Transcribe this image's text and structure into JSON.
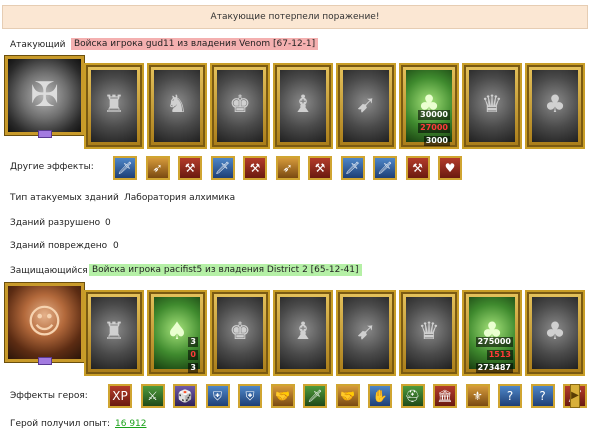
{
  "banner": "Атакующие потерпели поражение!",
  "attacker": {
    "label": "Атакующий",
    "army": "Войска игрока gud11 из владения Venom [67-12-1]",
    "units": [
      {
        "icon": "dwarf-icon",
        "style": "grey"
      },
      {
        "icon": "knight-icon",
        "style": "grey"
      },
      {
        "icon": "paladin-icon",
        "style": "grey"
      },
      {
        "icon": "griffin-icon",
        "style": "grey"
      },
      {
        "icon": "archer-icon",
        "style": "grey"
      },
      {
        "icon": "ent-icon",
        "style": "green",
        "counts": [
          {
            "v": "30000",
            "c": "w"
          },
          {
            "v": "27000",
            "c": "r"
          },
          {
            "v": "3000",
            "c": "w"
          }
        ]
      },
      {
        "icon": "warrior-icon",
        "style": "grey"
      },
      {
        "icon": "ent-icon",
        "style": "grey"
      }
    ]
  },
  "other_effects": {
    "label": "Другие эффекты:",
    "items": [
      {
        "icon": "sword-icon",
        "c": "b"
      },
      {
        "icon": "bow-icon",
        "c": "o"
      },
      {
        "icon": "axe-icon",
        "c": "r"
      },
      {
        "icon": "sword-icon",
        "c": "b"
      },
      {
        "icon": "axe-icon",
        "c": "r"
      },
      {
        "icon": "bow-icon",
        "c": "o"
      },
      {
        "icon": "axe-icon",
        "c": "r"
      },
      {
        "icon": "sword-icon",
        "c": "b"
      },
      {
        "icon": "sword-icon",
        "c": "b"
      },
      {
        "icon": "axe-icon",
        "c": "r"
      },
      {
        "icon": "heart-icon",
        "c": "r"
      }
    ]
  },
  "building_type": {
    "label": "Тип атакуемых зданий",
    "value": "Лаборатория алхимика"
  },
  "destroyed": {
    "label": "Зданий разрушено",
    "value": "0"
  },
  "damaged": {
    "label": "Зданий повреждено",
    "value": "0"
  },
  "defender": {
    "label": "Защищающийся",
    "army": "Войска игрока pacifist5 из владения District 2 [65-12-41]",
    "units": [
      {
        "icon": "dwarf-icon",
        "style": "grey"
      },
      {
        "icon": "elf-icon",
        "style": "green",
        "counts": [
          {
            "v": "3",
            "c": "w"
          },
          {
            "v": "0",
            "c": "r"
          },
          {
            "v": "3",
            "c": "w"
          }
        ]
      },
      {
        "icon": "paladin-icon",
        "style": "grey"
      },
      {
        "icon": "griffin-icon",
        "style": "grey"
      },
      {
        "icon": "archer-icon",
        "style": "grey"
      },
      {
        "icon": "warrior-icon",
        "style": "grey"
      },
      {
        "icon": "ent-icon",
        "style": "green",
        "counts": [
          {
            "v": "275000",
            "c": "w"
          },
          {
            "v": "1513",
            "c": "r"
          },
          {
            "v": "273487",
            "c": "w"
          }
        ]
      },
      {
        "icon": "ent-icon",
        "style": "grey"
      }
    ]
  },
  "hero_effects": {
    "label": "Эффекты героя:",
    "items": [
      {
        "glyph": "XP",
        "icon": "xp-icon",
        "c": "r"
      },
      {
        "glyph": "⚔",
        "icon": "swords-icon",
        "c": "g"
      },
      {
        "glyph": "🎲",
        "icon": "dice-icon",
        "c": "p"
      },
      {
        "glyph": "⛨",
        "icon": "shield-icon",
        "c": "b"
      },
      {
        "glyph": "⛨",
        "icon": "shield-icon",
        "c": "b"
      },
      {
        "glyph": "🤝",
        "icon": "handshake-icon",
        "c": "o"
      },
      {
        "glyph": "🗡",
        "icon": "sword-icon",
        "c": "g"
      },
      {
        "glyph": "🤝",
        "icon": "handshake-icon",
        "c": "o"
      },
      {
        "glyph": "✋",
        "icon": "hand-icon",
        "c": "b"
      },
      {
        "glyph": "⛑",
        "icon": "helmet-icon",
        "c": "g"
      },
      {
        "glyph": "🏛",
        "icon": "building-icon",
        "c": "r"
      },
      {
        "glyph": "⚜",
        "icon": "emblem-icon",
        "c": "o"
      },
      {
        "glyph": "?",
        "icon": "question-icon",
        "c": "b"
      },
      {
        "glyph": "?",
        "icon": "question-icon",
        "c": "b"
      },
      {
        "glyph": "🗡",
        "icon": "sword-icon",
        "c": "r"
      }
    ]
  },
  "hero_xp": {
    "label": "Герой получил опыт:",
    "value": "16 912"
  }
}
